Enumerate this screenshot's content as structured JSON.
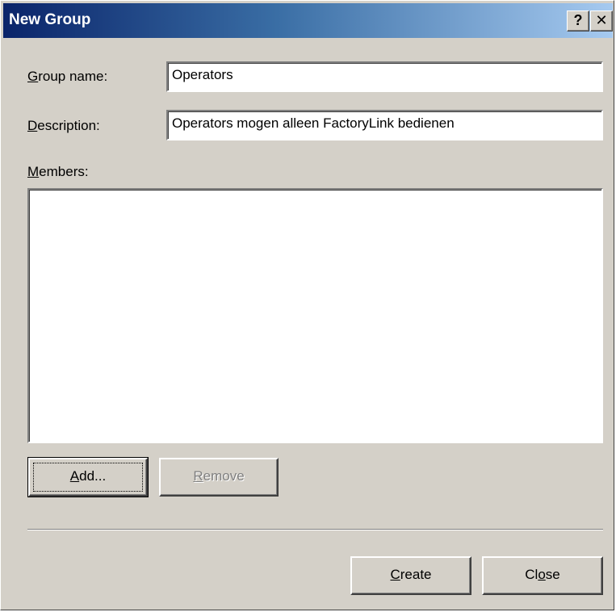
{
  "window": {
    "title": "New Group",
    "help_glyph": "?",
    "close_glyph": "✕"
  },
  "form": {
    "group_name": {
      "label_mnemonic": "G",
      "label_rest": "roup name:",
      "value": "Operators"
    },
    "description": {
      "label_mnemonic": "D",
      "label_rest": "escription:",
      "value": "Operators mogen alleen FactoryLink bedienen"
    },
    "members": {
      "label_mnemonic": "M",
      "label_rest": "embers:",
      "items": []
    }
  },
  "buttons": {
    "add": {
      "mnemonic": "A",
      "rest": "dd...",
      "enabled": true
    },
    "remove": {
      "mnemonic": "R",
      "rest": "emove",
      "enabled": false
    },
    "create": {
      "mnemonic": "C",
      "rest": "reate"
    },
    "close": {
      "before": "Cl",
      "mnemonic": "o",
      "after": "se"
    }
  },
  "icons": {
    "help": "help-icon",
    "close": "close-icon"
  },
  "colors": {
    "title_start": "#0a246a",
    "title_end": "#a6caf0",
    "face": "#d4d0c8"
  }
}
